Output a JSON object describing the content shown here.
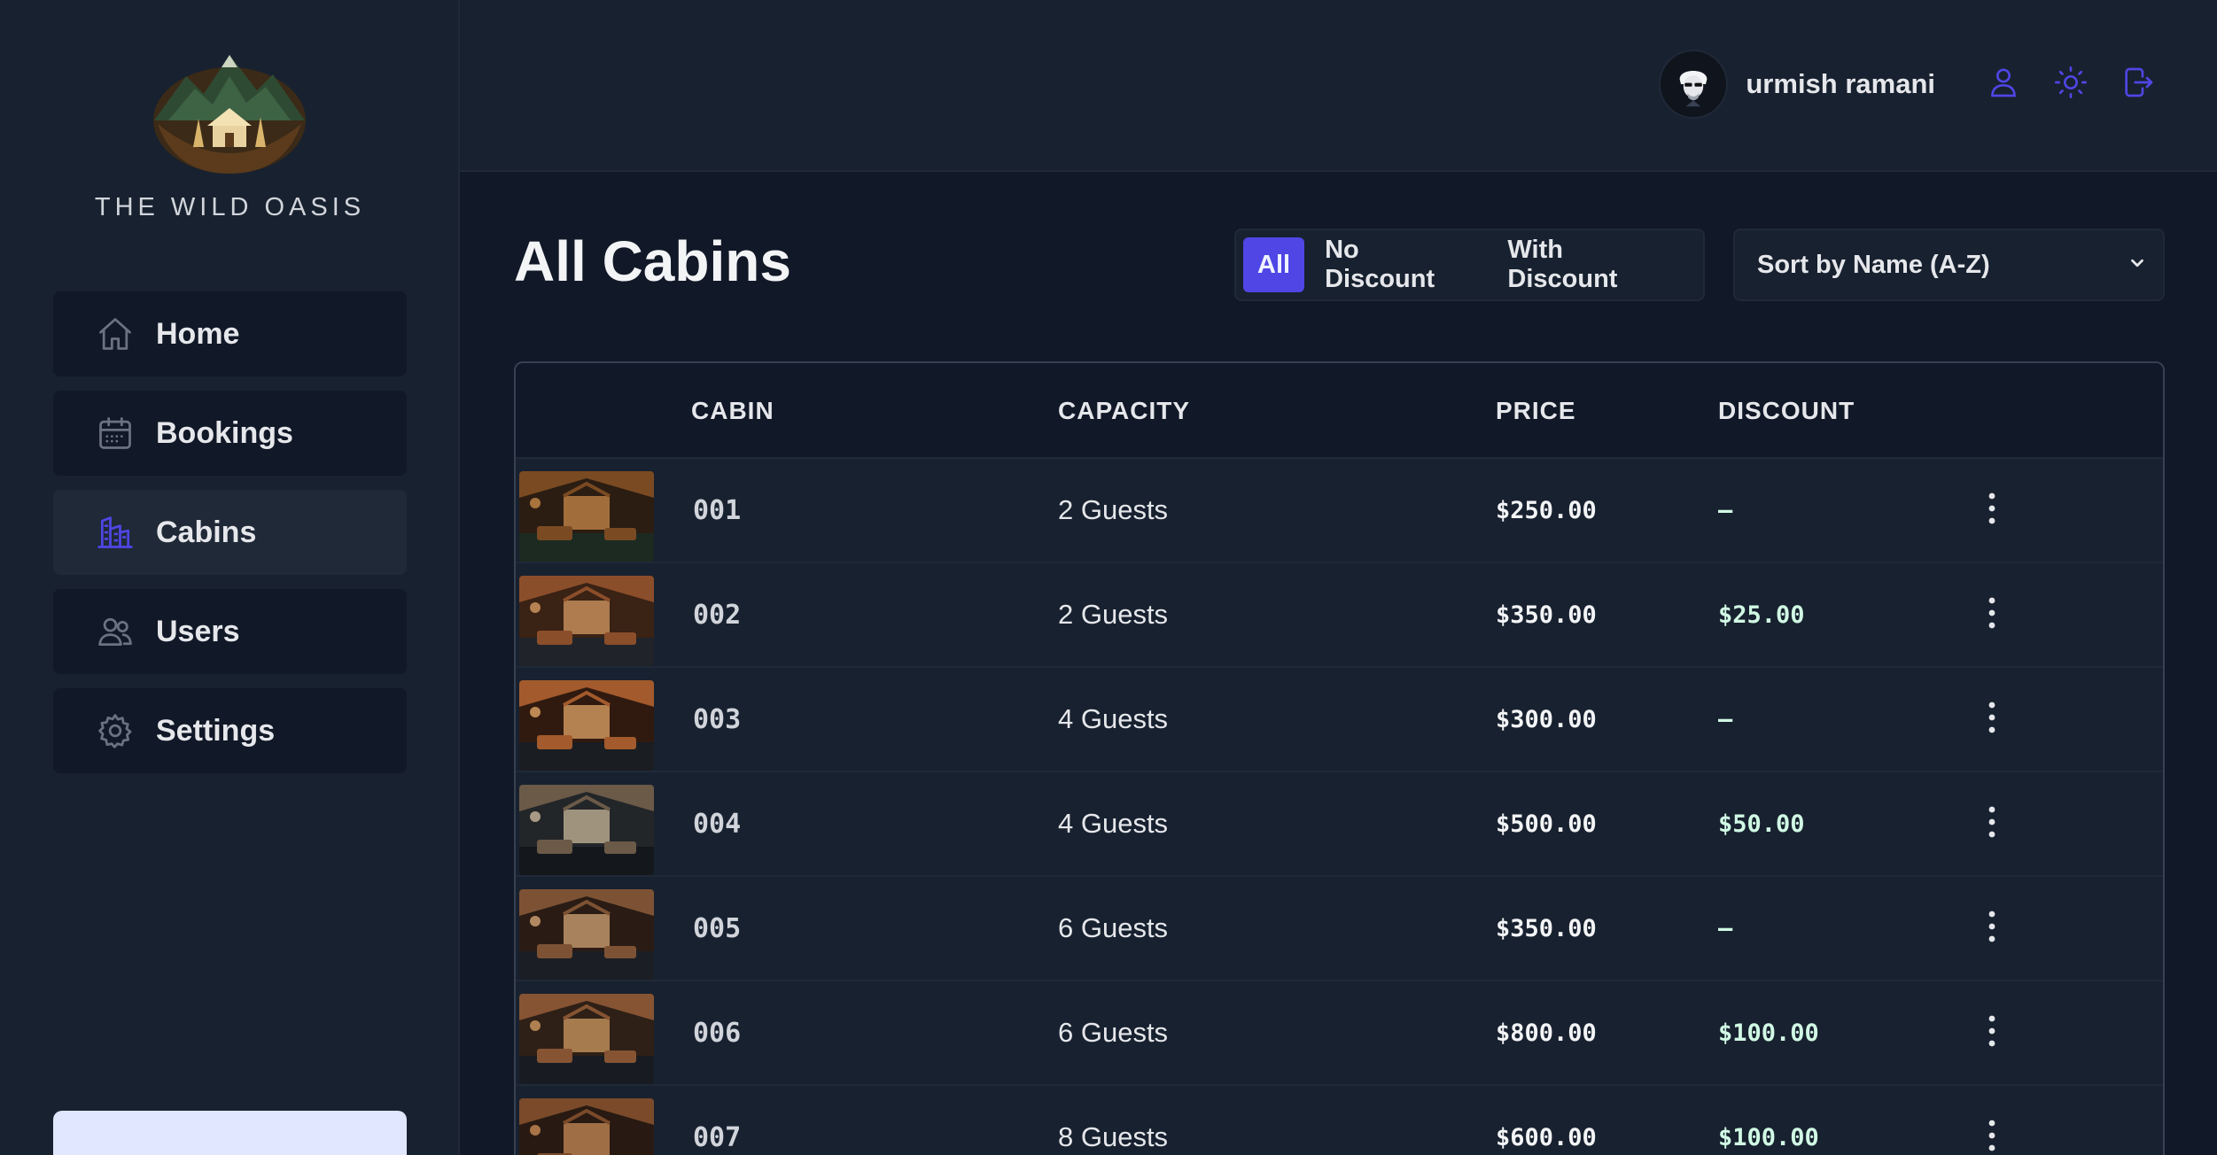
{
  "sidebar": {
    "brand": "THE WILD OASIS",
    "items": [
      {
        "label": "Home",
        "icon": "home-icon",
        "active": false
      },
      {
        "label": "Bookings",
        "icon": "calendar-icon",
        "active": false
      },
      {
        "label": "Cabins",
        "icon": "cabin-icon",
        "active": true
      },
      {
        "label": "Users",
        "icon": "users-icon",
        "active": false
      },
      {
        "label": "Settings",
        "icon": "gear-icon",
        "active": false
      }
    ]
  },
  "header": {
    "username": "urmish ramani",
    "buttons": [
      "user-icon",
      "sun-icon",
      "logout-icon"
    ]
  },
  "main": {
    "title": "All Cabins",
    "filters": [
      {
        "label": "All",
        "active": true
      },
      {
        "label": "No Discount",
        "active": false
      },
      {
        "label": "With Discount",
        "active": false
      }
    ],
    "sort": "Sort by Name (A-Z)"
  },
  "table": {
    "columns": [
      "",
      "CABIN",
      "CAPACITY",
      "PRICE",
      "DISCOUNT",
      ""
    ],
    "rows": [
      {
        "name": "001",
        "capacity": "2 Guests",
        "price": "$250.00",
        "discount": "—"
      },
      {
        "name": "002",
        "capacity": "2 Guests",
        "price": "$350.00",
        "discount": "$25.00"
      },
      {
        "name": "003",
        "capacity": "4 Guests",
        "price": "$300.00",
        "discount": "—"
      },
      {
        "name": "004",
        "capacity": "4 Guests",
        "price": "$500.00",
        "discount": "$50.00"
      },
      {
        "name": "005",
        "capacity": "6 Guests",
        "price": "$350.00",
        "discount": "—"
      },
      {
        "name": "006",
        "capacity": "6 Guests",
        "price": "$800.00",
        "discount": "$100.00"
      },
      {
        "name": "007",
        "capacity": "8 Guests",
        "price": "$600.00",
        "discount": "$100.00"
      }
    ]
  },
  "colors": {
    "accent": "#4f46e5",
    "icon_accent": "#4f46e5",
    "background": "#111827",
    "panel": "#18212f"
  }
}
